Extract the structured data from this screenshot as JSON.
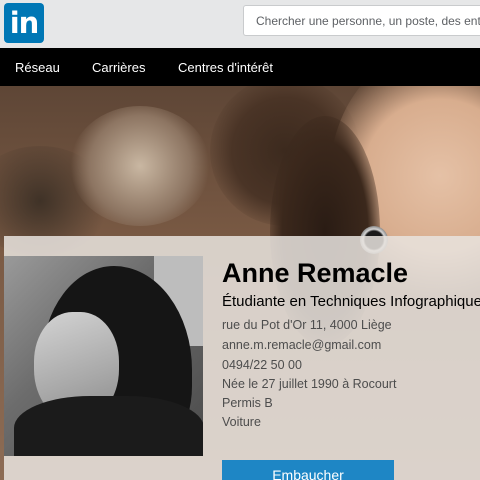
{
  "header": {
    "logo_text": "in",
    "search_placeholder": "Chercher une personne, un poste, des entre"
  },
  "nav": {
    "items": [
      "Réseau",
      "Carrières",
      "Centres d'intérêt"
    ]
  },
  "profile": {
    "name": "Anne Remacle",
    "headline": "Étudiante en Techniques Infographique",
    "address": "rue du Pot d'Or 11, 4000 Liège",
    "email": "anne.m.remacle@gmail.com",
    "phone": "0494/22 50 00",
    "birth": "Née le 27 juillet 1990 à Rocourt",
    "license": "Permis B",
    "vehicle": "Voiture",
    "hire_label": "Embaucher"
  },
  "colors": {
    "brand": "#0077b5",
    "nav_bg": "#000000",
    "button": "#1e86c5"
  },
  "icons": {
    "logo": "linkedin-logo"
  }
}
